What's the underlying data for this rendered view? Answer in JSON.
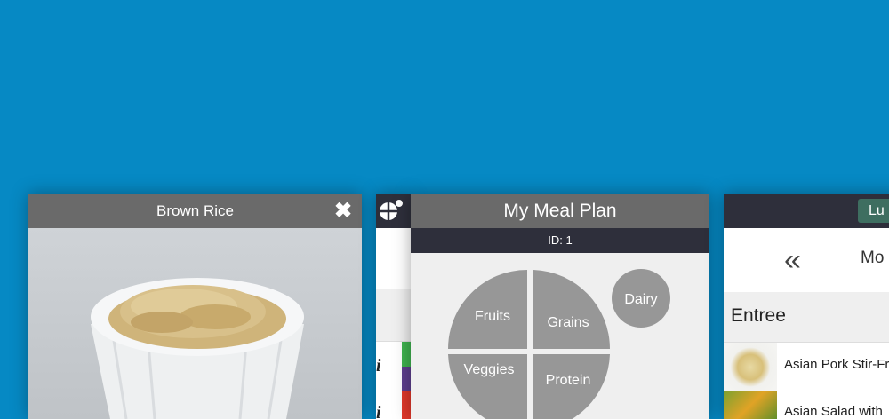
{
  "detail_card": {
    "title": "Brown Rice",
    "close_icon": "close-icon",
    "image": "brown-rice-photo"
  },
  "narrow_card": {
    "logo_icon": "meal-plan-logo-icon",
    "rows": [
      {
        "glyph": "i",
        "tag_colors": [
          "#3fb34f",
          "#5e3f8e"
        ]
      },
      {
        "glyph": "i",
        "tag_colors": [
          "#e1382b"
        ]
      }
    ]
  },
  "meal_plan": {
    "title": "My Meal Plan",
    "id_label": "ID: 1",
    "plate": {
      "sections": [
        "Fruits",
        "Grains",
        "Veggies",
        "Protein"
      ],
      "side": "Dairy",
      "fill": "#979797"
    }
  },
  "menu_card": {
    "meal_pill": "Lu",
    "back_icon": "double-chevron-left-icon",
    "day_label": "Mo",
    "section": "Entree",
    "items": [
      {
        "name": "Asian Pork Stir-Fr"
      },
      {
        "name": "Asian Salad with"
      }
    ],
    "accent": "#3e6e60"
  }
}
